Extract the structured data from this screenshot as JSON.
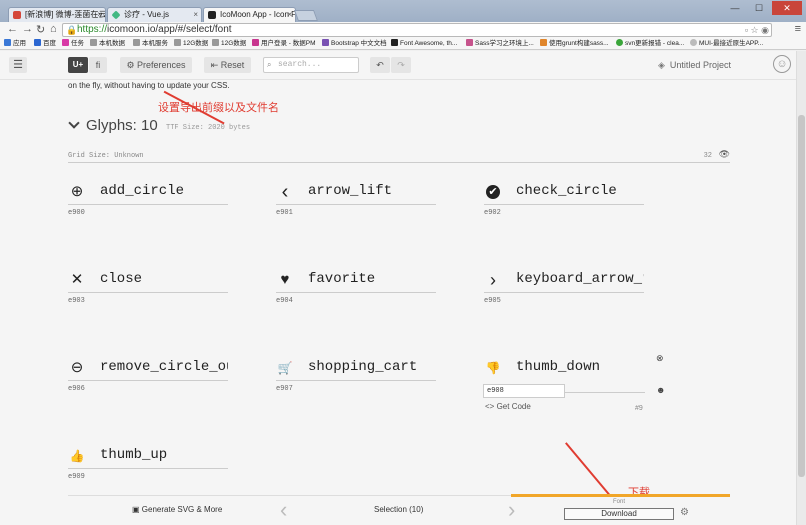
{
  "browser": {
    "tabs": [
      {
        "label": "[新浪博] 微博-莲菌在云",
        "color": "#d4473b"
      },
      {
        "label": "诊疗 - Vue.js",
        "color": "#41b883"
      },
      {
        "label": "IcoMoon App - Icon Font",
        "color": "#222"
      }
    ],
    "url_scheme": "https://",
    "url_rest": "icomoon.io/app/#/select/font",
    "bookmarks": [
      "应用",
      "百度",
      "任务",
      "本机数据",
      "本机服务",
      "12G数据",
      "12G数据",
      "用户登录 - 数据PM",
      "Bootstrap 中文文档",
      "Font Awesome, th...",
      "Sass学习之环境上...",
      "使用grunt构建sass...",
      "svn更新报错 - clea...",
      "MUI-最接近原生APP..."
    ]
  },
  "toolbar": {
    "menu_icon": "☰",
    "u_label": "U+",
    "fi_label": "fi",
    "preferences_label": "Preferences",
    "reset_label": "Reset",
    "search_placeholder": "search...",
    "project_name": "Untitled Project"
  },
  "content": {
    "intro_text": "on the fly, without having to update your CSS.",
    "glyphs_title": "Glyphs: 10",
    "ttf_size": "TTF Size: 2020 bytes",
    "grid_size": "Grid Size: Unknown",
    "grid_num": "32"
  },
  "glyphs": [
    {
      "name": "add_circle",
      "code": "e900",
      "icon": "⊕"
    },
    {
      "name": "arrow_lift",
      "code": "e901",
      "icon": "‹"
    },
    {
      "name": "check_circle",
      "code": "e902",
      "icon": "✔"
    },
    {
      "name": "close",
      "code": "e903",
      "icon": "✕"
    },
    {
      "name": "favorite",
      "code": "e904",
      "icon": "♥"
    },
    {
      "name": "keyboard_arrow_r",
      "code": "e905",
      "icon": "›"
    },
    {
      "name": "remove_circle_ou",
      "code": "e906",
      "icon": "⊖"
    },
    {
      "name": "shopping_cart",
      "code": "e907",
      "icon": "🛒"
    },
    {
      "name": "thumb_down",
      "code": "e908",
      "icon": "👎"
    },
    {
      "name": "thumb_up",
      "code": "e909",
      "icon": "👍"
    }
  ],
  "selected": {
    "code_value": "e908",
    "get_code": "Get Code",
    "hash": "#9"
  },
  "annotations": {
    "preferences_note": "设置导出前缀以及文件名",
    "download_note": "下载"
  },
  "footer": {
    "generate_label": "Generate SVG & More",
    "selection_label": "Selection (10)",
    "font_label": "Font",
    "download_label": "Download"
  }
}
